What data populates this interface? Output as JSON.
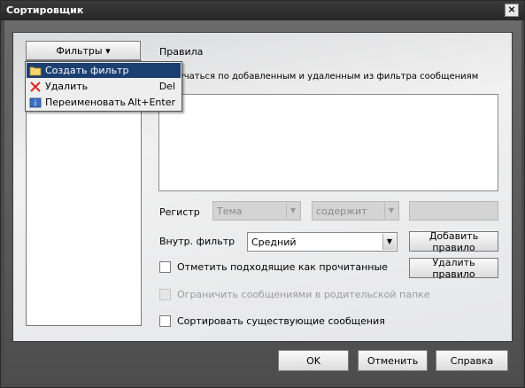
{
  "window": {
    "title": "Сортировщик",
    "close_label": "×"
  },
  "left_panel": {
    "filters_button": "Фильтры ▾"
  },
  "context_menu": {
    "items": [
      {
        "label": "Создать фильтр",
        "shortcut": "",
        "icon": "folder-icon"
      },
      {
        "label": "Удалить",
        "shortcut": "Del",
        "icon": "delete-x-icon"
      },
      {
        "label": "Переименовать",
        "shortcut": "Alt+Enter",
        "icon": "rename-icon"
      }
    ]
  },
  "rules": {
    "title": "Правила",
    "learn_label": "...обучаться по добавленным и удаленным из фильтра сообщениям",
    "register_label": "Регистр",
    "subject_value": "Тема",
    "contains_value": "содержит",
    "inner_filter_label": "Внутр. фильтр",
    "inner_filter_value": "Средний",
    "add_rule_button": "Добавить правило",
    "remove_rule_button": "Удалить правило",
    "mark_read_label": "Отметить подходящие как прочитанные",
    "limit_parent_label": "Ограничить сообщениями в родительской папке",
    "sort_existing_label": "Сортировать существующие сообщения"
  },
  "footer": {
    "ok": "OK",
    "cancel": "Отменить",
    "help": "Справка"
  }
}
